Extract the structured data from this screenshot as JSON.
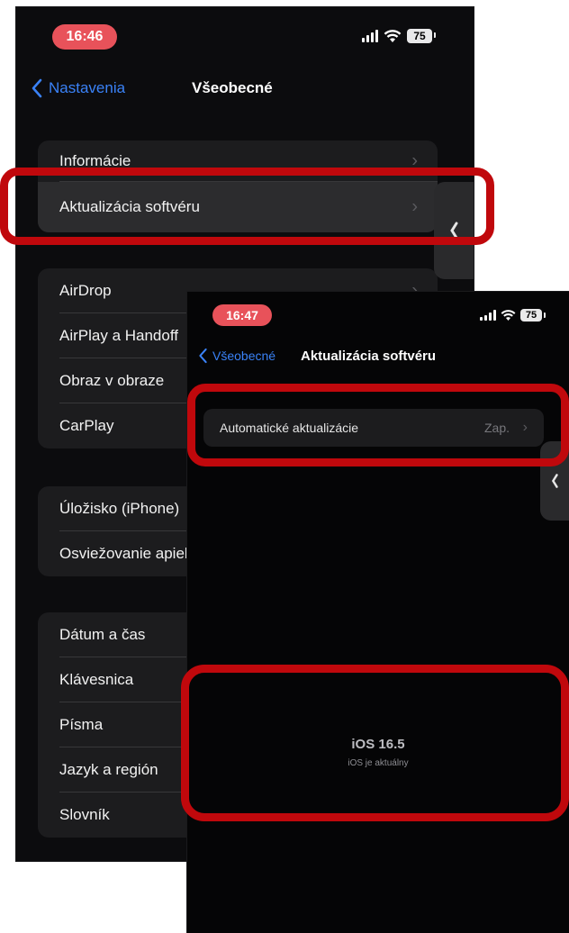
{
  "screen1": {
    "time": "16:46",
    "battery": "75",
    "back_label": "Nastavenia",
    "title": "Všeobecné",
    "group1": [
      "Informácie",
      "Aktualizácia softvéru"
    ],
    "group2": [
      "AirDrop",
      "AirPlay a Handoff",
      "Obraz v obraze",
      "CarPlay"
    ],
    "group3": [
      "Úložisko (iPhone)",
      "Osviežovanie apiek na pozadí"
    ],
    "group4": [
      "Dátum a čas",
      "Klávesnica",
      "Písma",
      "Jazyk a región",
      "Slovník"
    ]
  },
  "screen2": {
    "time": "16:47",
    "battery": "75",
    "back_label": "Všeobecné",
    "title": "Aktualizácia softvéru",
    "auto_updates_label": "Automatické aktualizácie",
    "auto_updates_value": "Zap.",
    "ios_version": "iOS 16.5",
    "ios_status": "iOS je aktuálny"
  },
  "colors": {
    "highlight": "#c0080c",
    "accent": "#3a82f7",
    "time_pill": "#e8525a"
  }
}
